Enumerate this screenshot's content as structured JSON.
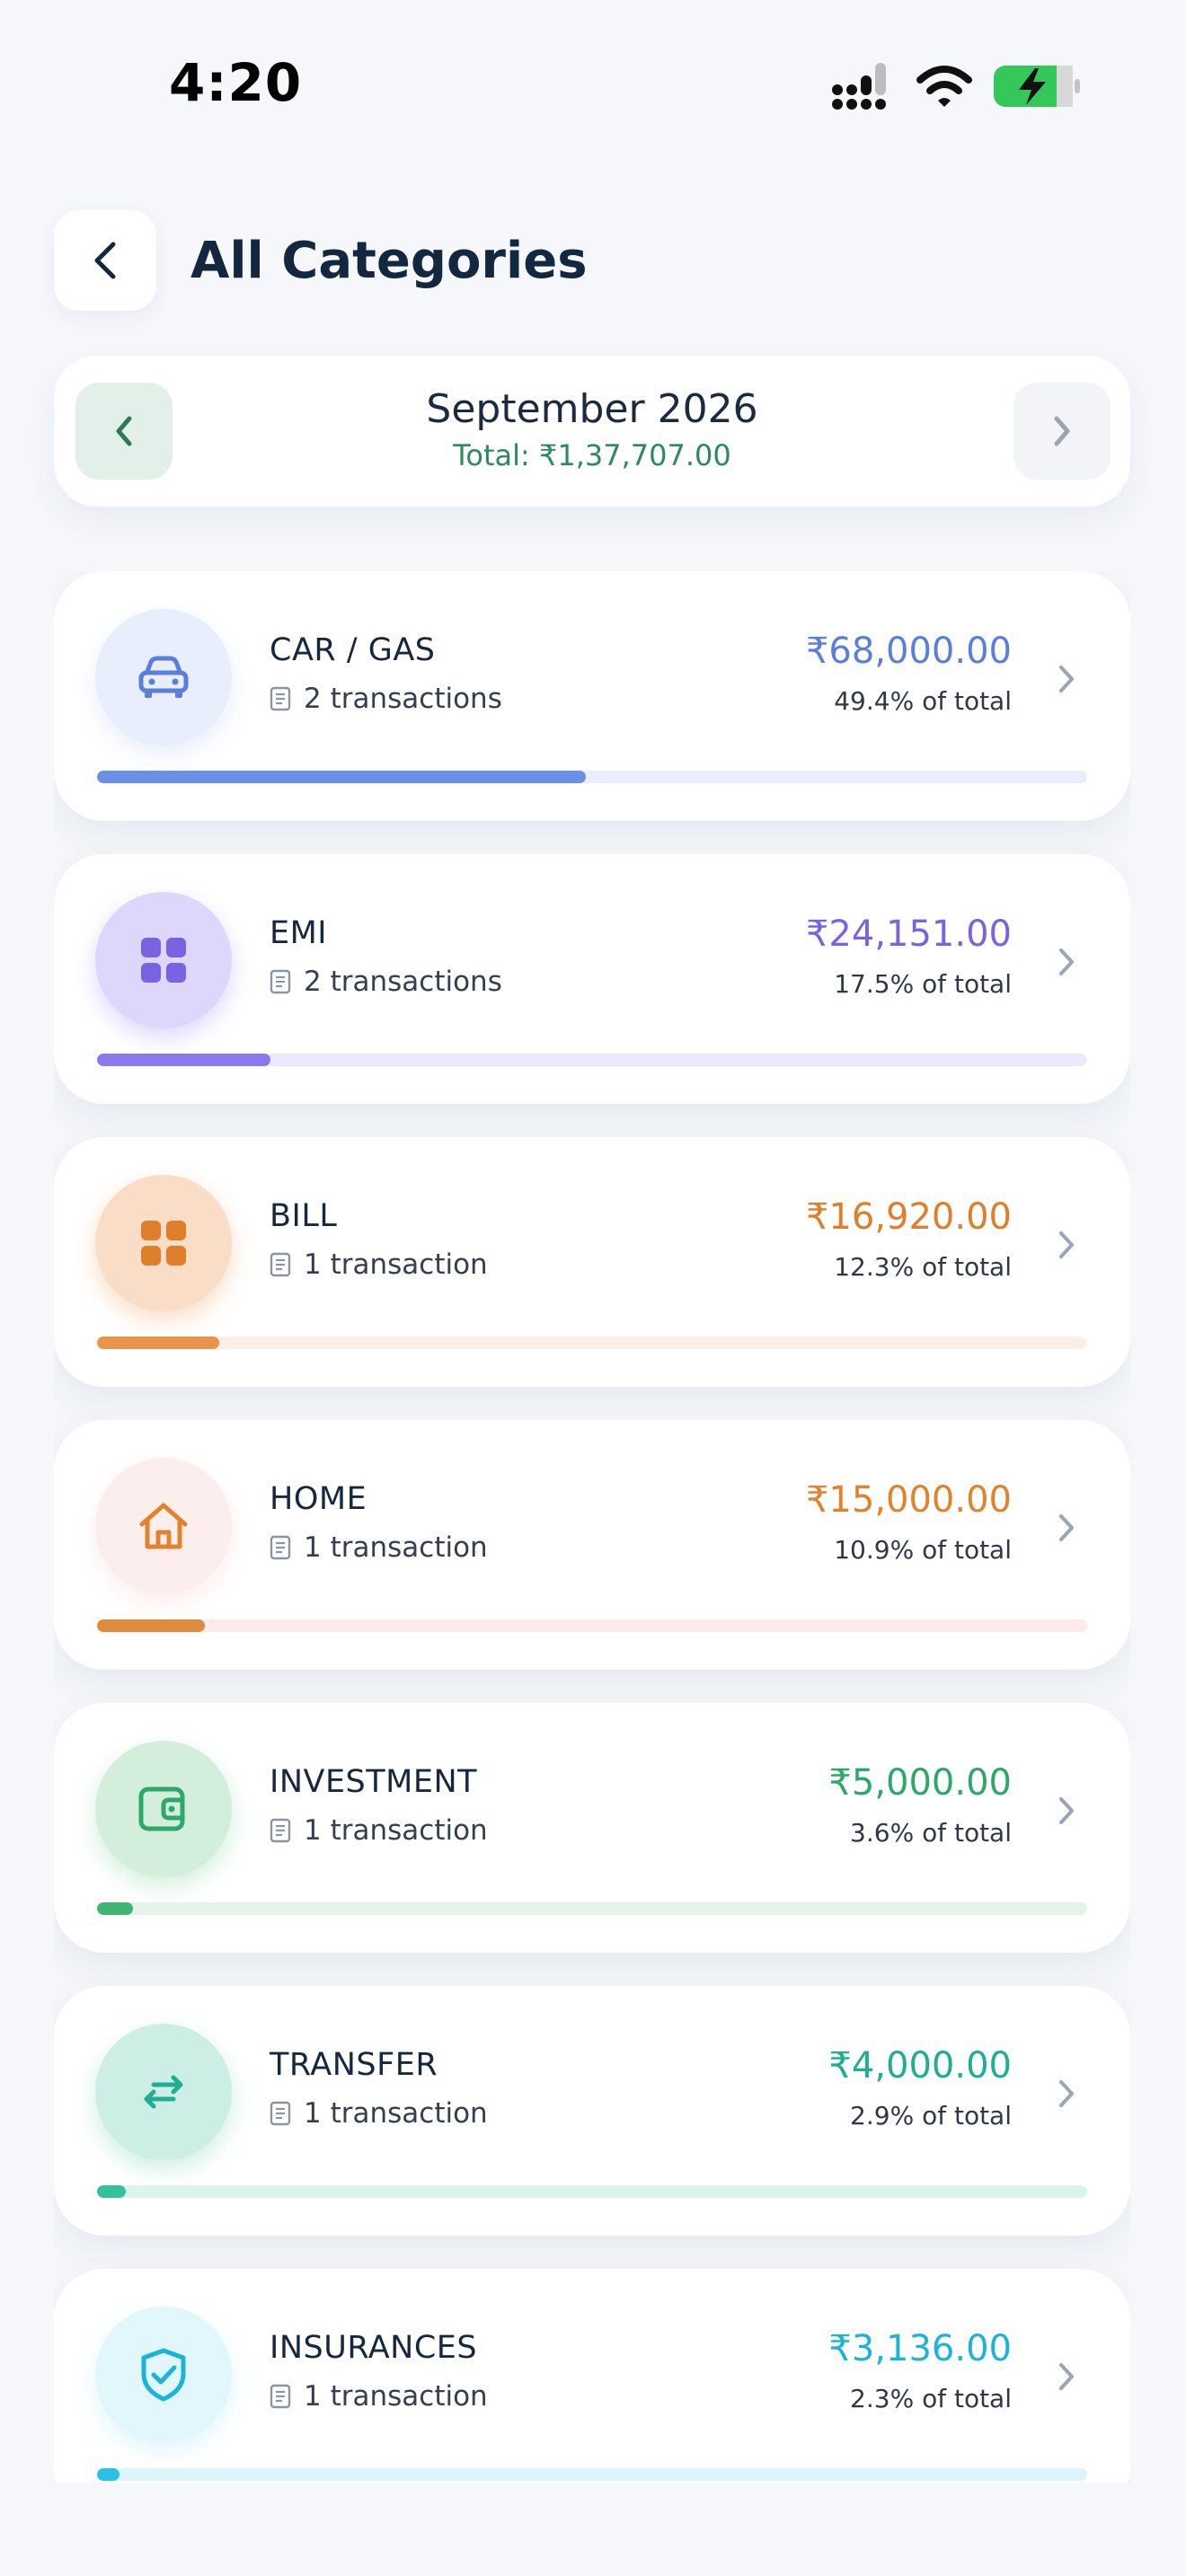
{
  "status_bar": {
    "time": "4:20"
  },
  "header": {
    "title": "All Categories",
    "back_icon": "chevron-left-icon"
  },
  "month_selector": {
    "label": "September 2026",
    "total": "Total: ₹1,37,707.00"
  },
  "colors": {
    "background": "#f5f7fb",
    "title": "#13283f",
    "total_green": "#2c8a5e"
  },
  "categories": [
    {
      "name": "CAR / GAS",
      "count": "2 transactions",
      "amount": "₹68,000.00",
      "percent_label": "49.4% of total",
      "percent": 49.4,
      "icon": "car-icon",
      "color": "#5b7fd9",
      "icon_bg": "#e8eefc",
      "track_bg": "#e9eefb",
      "bar": "#6b8fe2"
    },
    {
      "name": "EMI",
      "count": "2 transactions",
      "amount": "₹24,151.00",
      "percent_label": "17.5% of total",
      "percent": 17.5,
      "icon": "grid-icon",
      "color": "#7a63e0",
      "icon_bg": "#ddd8fb",
      "track_bg": "#ebe9fb",
      "bar": "#8b78ec"
    },
    {
      "name": "BILL",
      "count": "1 transaction",
      "amount": "₹16,920.00",
      "percent_label": "12.3% of total",
      "percent": 12.3,
      "icon": "grid-icon",
      "color": "#e07f2b",
      "icon_bg": "#f9ddc6",
      "track_bg": "#fcefe4",
      "bar": "#e8944b"
    },
    {
      "name": "HOME",
      "count": "1 transaction",
      "amount": "₹15,000.00",
      "percent_label": "10.9% of total",
      "percent": 10.9,
      "icon": "home-icon",
      "color": "#e1822c",
      "icon_bg": "#fdeeee",
      "track_bg": "#fdeaea",
      "bar": "#e08a3e"
    },
    {
      "name": "INVESTMENT",
      "count": "1 transaction",
      "amount": "₹5,000.00",
      "percent_label": "3.6% of total",
      "percent": 3.6,
      "icon": "wallet-icon",
      "color": "#2ea868",
      "icon_bg": "#d3efdc",
      "track_bg": "#e3f4ea",
      "bar": "#3fb574"
    },
    {
      "name": "TRANSFER",
      "count": "1 transaction",
      "amount": "₹4,000.00",
      "percent_label": "2.9% of total",
      "percent": 2.9,
      "icon": "transfer-arrows-icon",
      "color": "#1fae93",
      "icon_bg": "#cdeee4",
      "track_bg": "#dcf4ee",
      "bar": "#37c09e"
    },
    {
      "name": "INSURANCES",
      "count": "1 transaction",
      "amount": "₹3,136.00",
      "percent_label": "2.3% of total",
      "percent": 2.3,
      "icon": "shield-check-icon",
      "color": "#1db3d8",
      "icon_bg": "#e2f7fc",
      "track_bg": "#dcf5fa",
      "bar": "#2cc1e4"
    }
  ]
}
